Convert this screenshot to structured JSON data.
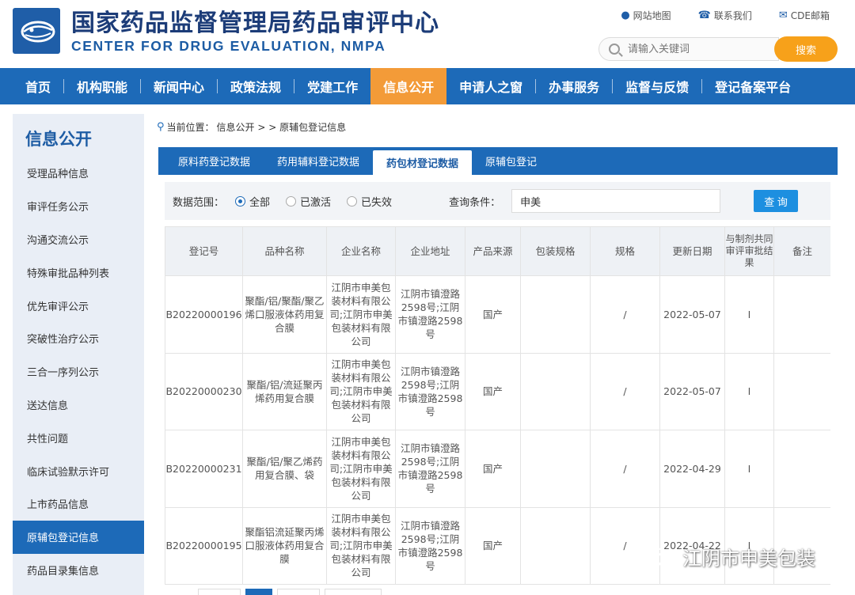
{
  "header": {
    "title_cn": "国家药品监督管理局药品审评中心",
    "title_en": "CENTER FOR DRUG EVALUATION, NMPA",
    "top_links": [
      {
        "label": "网站地图",
        "icon": "map-pin-icon"
      },
      {
        "label": "联系我们",
        "icon": "phone-icon"
      },
      {
        "label": "CDE邮箱",
        "icon": "mail-icon"
      }
    ],
    "search": {
      "placeholder": "请输入关键词",
      "button": "搜索"
    }
  },
  "nav": {
    "items": [
      "首页",
      "机构职能",
      "新闻中心",
      "政策法规",
      "党建工作",
      "信息公开",
      "申请人之窗",
      "办事服务",
      "监督与反馈",
      "登记备案平台"
    ],
    "active": "信息公开"
  },
  "sidebar": {
    "title": "信息公开",
    "items": [
      "受理品种信息",
      "审评任务公示",
      "沟通交流公示",
      "特殊审批品种列表",
      "优先审评公示",
      "突破性治疗公示",
      "三合一序列公示",
      "送达信息",
      "共性问题",
      "临床试验默示许可",
      "上市药品信息",
      "原辅包登记信息",
      "药品目录集信息"
    ],
    "active": "原辅包登记信息"
  },
  "breadcrumb": {
    "prefix": "当前位置：",
    "path": "信息公开 > > 原辅包登记信息"
  },
  "tabs": {
    "items": [
      "原料药登记数据",
      "药用辅料登记数据",
      "药包材登记数据",
      "原辅包登记"
    ],
    "active": "药包材登记数据"
  },
  "filter": {
    "scope_label": "数据范围：",
    "options": [
      "全部",
      "已激活",
      "已失效"
    ],
    "selected": "全部",
    "query_label": "查询条件：",
    "query_value": "申美",
    "query_button": "查 询"
  },
  "table": {
    "headers": [
      "登记号",
      "品种名称",
      "企业名称",
      "企业地址",
      "产品来源",
      "包装规格",
      "规格",
      "更新日期",
      "与制剂共同审评审批结果",
      "备注"
    ],
    "rows": [
      [
        "B20220000196",
        "聚酯/铝/聚酯/聚乙烯口服液体药用复合膜",
        "江阴市申美包装材料有限公司;江阴市申美包装材料有限公司",
        "江阴市镇澄路2598号;江阴市镇澄路2598号",
        "国产",
        "",
        "/",
        "2022-05-07",
        "I",
        ""
      ],
      [
        "B20220000230",
        "聚酯/铝/流延聚丙烯药用复合膜",
        "江阴市申美包装材料有限公司;江阴市申美包装材料有限公司",
        "江阴市镇澄路2598号;江阴市镇澄路2598号",
        "国产",
        "",
        "/",
        "2022-05-07",
        "I",
        ""
      ],
      [
        "B20220000231",
        "聚酯/铝/聚乙烯药用复合膜、袋",
        "江阴市申美包装材料有限公司;江阴市申美包装材料有限公司",
        "江阴市镇澄路2598号;江阴市镇澄路2598号",
        "国产",
        "",
        "/",
        "2022-04-29",
        "I",
        ""
      ],
      [
        "B20220000195",
        "聚酯铝流延聚丙烯口服液体药用复合膜",
        "江阴市申美包装材料有限公司;江阴市申美包装材料有限公司",
        "江阴市镇澄路2598号;江阴市镇澄路2598号",
        "国产",
        "",
        "/",
        "2022-04-22",
        "I",
        ""
      ]
    ]
  },
  "watermark": {
    "text": "江阴市申美包装",
    "icon": "wechat-icon"
  },
  "colors": {
    "brand_blue": "#1d6ab8",
    "nav_active": "#f39b38",
    "search_button": "#f7a11a",
    "title_navy": "#1c3c78"
  }
}
